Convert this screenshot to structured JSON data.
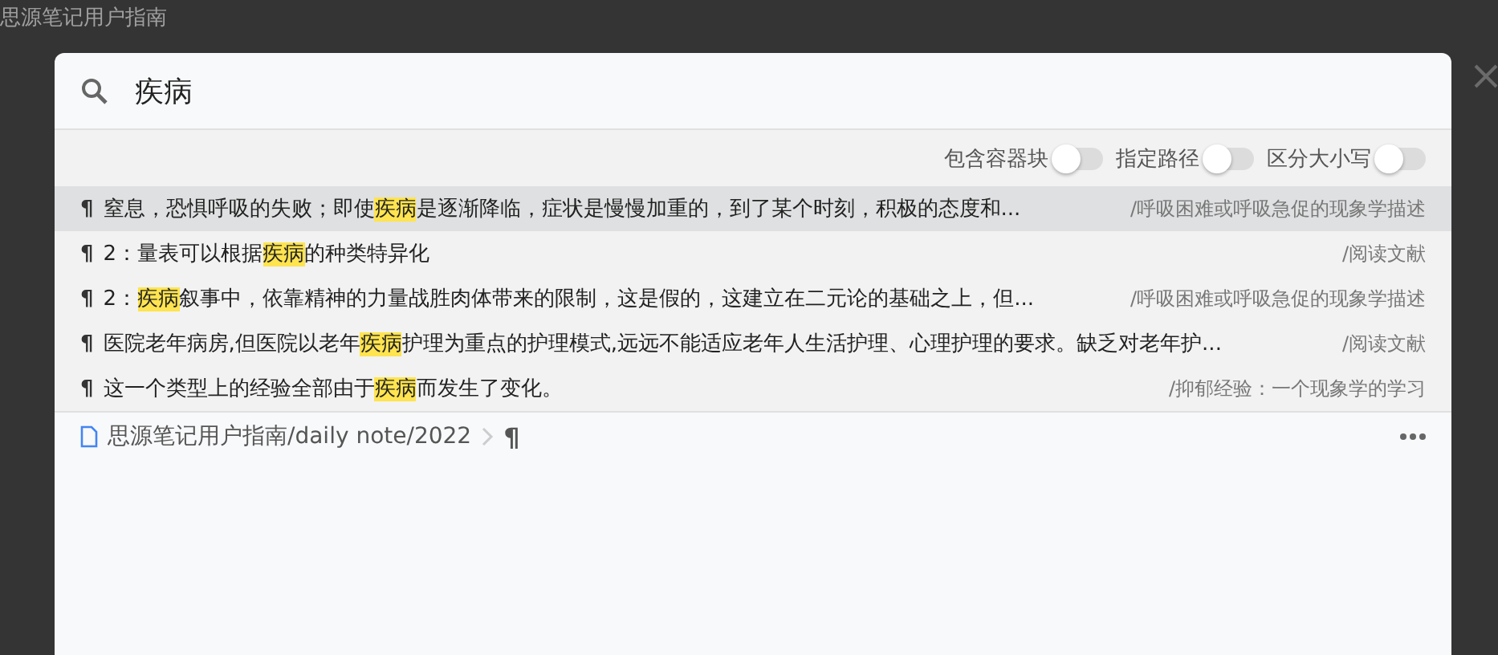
{
  "window": {
    "title": "思源笔记用户指南"
  },
  "search": {
    "value": "疾病"
  },
  "options": [
    {
      "label": "包含容器块",
      "on": false
    },
    {
      "label": "指定路径",
      "on": false
    },
    {
      "label": "区分大小写",
      "on": false
    }
  ],
  "results": [
    {
      "icon": "¶",
      "selected": true,
      "parts": [
        {
          "text": "窒息，恐惧呼吸的失败；即使",
          "match": false
        },
        {
          "text": "疾病",
          "match": true
        },
        {
          "text": "是逐渐降临，症状是慢慢加重的，到了某个时刻，积极的态度和...",
          "match": false
        }
      ],
      "path": "/呼吸困难或呼吸急促的现象学描述"
    },
    {
      "icon": "¶",
      "selected": false,
      "parts": [
        {
          "text": "2：量表可以根据",
          "match": false
        },
        {
          "text": "疾病",
          "match": true
        },
        {
          "text": "的种类特异化",
          "match": false
        }
      ],
      "path": "/阅读文献"
    },
    {
      "icon": "¶",
      "selected": false,
      "parts": [
        {
          "text": "2：",
          "match": false
        },
        {
          "text": "疾病",
          "match": true
        },
        {
          "text": "叙事中，依靠精神的力量战胜肉体带来的限制，这是假的，这建立在二元论的基础之上，但...",
          "match": false
        }
      ],
      "path": "/呼吸困难或呼吸急促的现象学描述"
    },
    {
      "icon": "¶",
      "selected": false,
      "parts": [
        {
          "text": "医院老年病房,但医院以老年",
          "match": false
        },
        {
          "text": "疾病",
          "match": true
        },
        {
          "text": "护理为重点的护理模式,远远不能适应老年人生活护理、心理护理的要求。缺乏对老年护...",
          "match": false
        }
      ],
      "path": "/阅读文献"
    },
    {
      "icon": "¶",
      "selected": false,
      "parts": [
        {
          "text": "这一个类型上的经验全部由于",
          "match": false
        },
        {
          "text": "疾病",
          "match": true
        },
        {
          "text": "而发生了变化。",
          "match": false
        }
      ],
      "path": "/抑郁经验：一个现象学的学习"
    }
  ],
  "breadcrumb": {
    "path": "思源笔记用户指南/daily note/2022",
    "last": "¶"
  }
}
